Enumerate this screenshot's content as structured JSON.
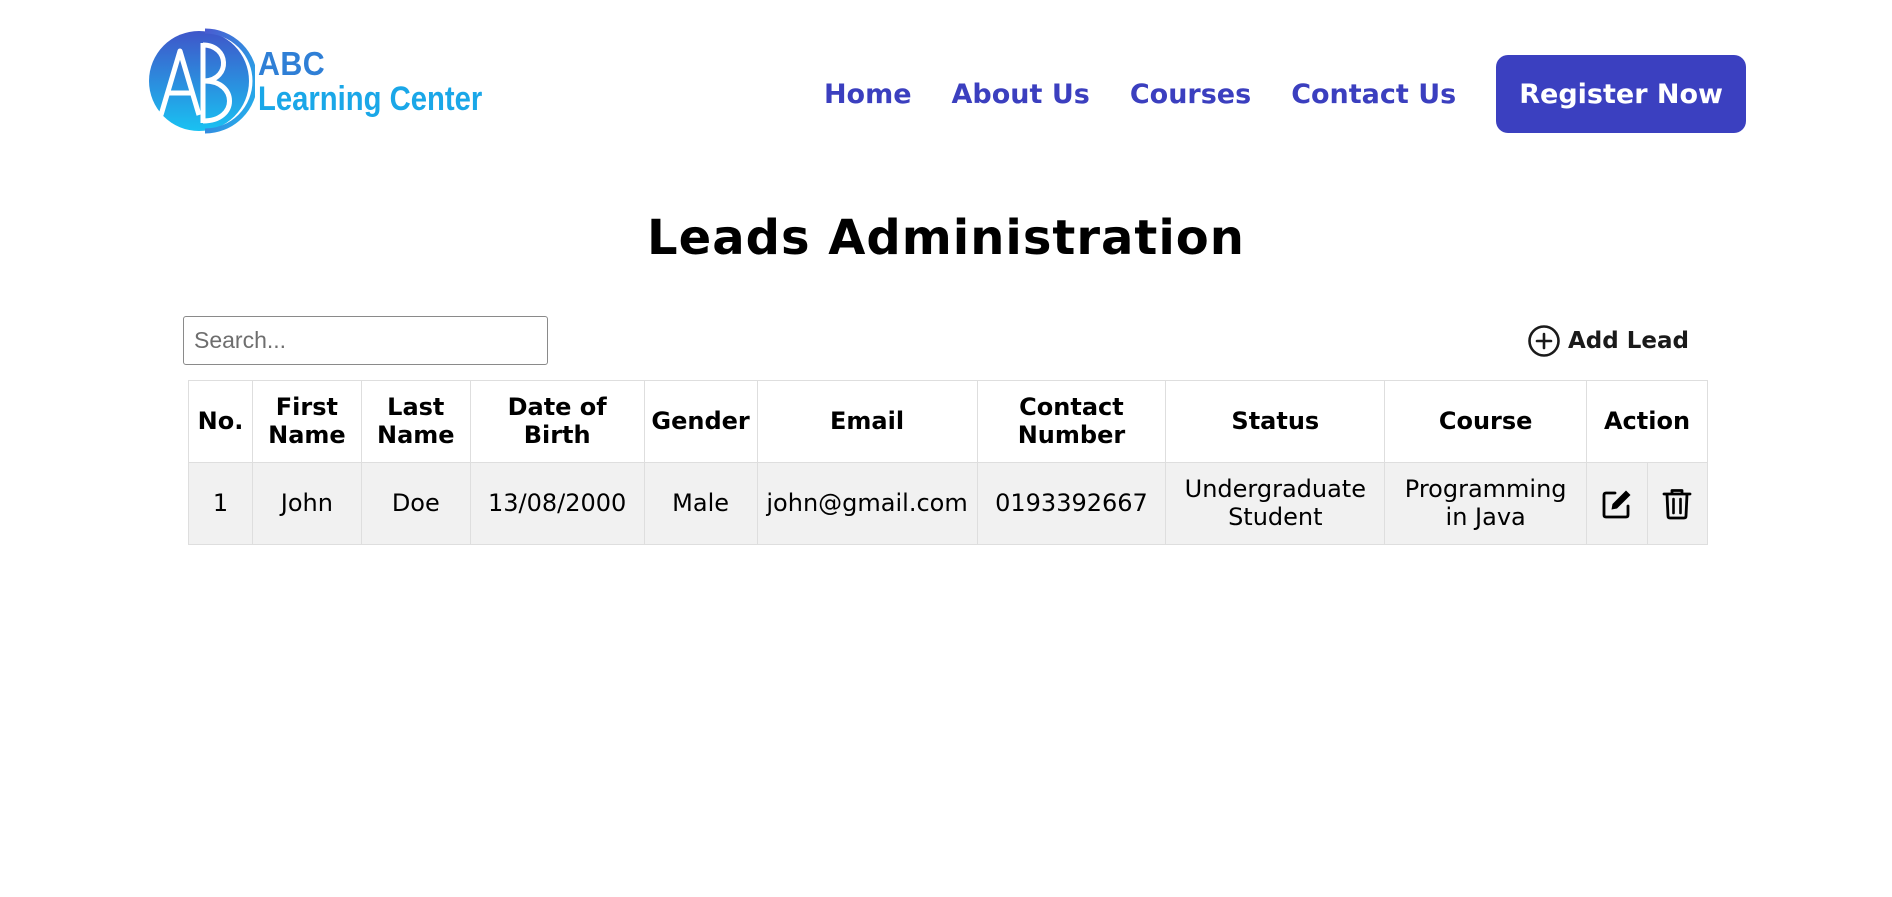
{
  "brand": {
    "line1": "ABC",
    "line2": "Learning Center",
    "colors": {
      "primary": "#2f7fd6",
      "secondary": "#1aa7e8"
    }
  },
  "nav": {
    "items": [
      "Home",
      "About Us",
      "Courses",
      "Contact Us"
    ],
    "register_label": "Register Now",
    "link_color": "#3b3fbf",
    "button_color": "#3b40c0"
  },
  "page": {
    "title": "Leads Administration"
  },
  "toolbar": {
    "search_placeholder": "Search...",
    "search_value": "",
    "add_lead_label": "Add Lead",
    "add_lead_icon": "plus-circle-icon"
  },
  "table": {
    "headers": [
      "No.",
      "First Name",
      "Last Name",
      "Date of Birth",
      "Gender",
      "Email",
      "Contact Number",
      "Status",
      "Course",
      "Action"
    ],
    "rows": [
      {
        "no": "1",
        "first_name": "John",
        "last_name": "Doe",
        "dob": "13/08/2000",
        "gender": "Male",
        "email": "john@gmail.com",
        "contact": "0193392667",
        "status": "Undergraduate Student",
        "course": "Programming in Java",
        "actions": [
          "edit-icon",
          "trash-icon"
        ]
      }
    ]
  }
}
